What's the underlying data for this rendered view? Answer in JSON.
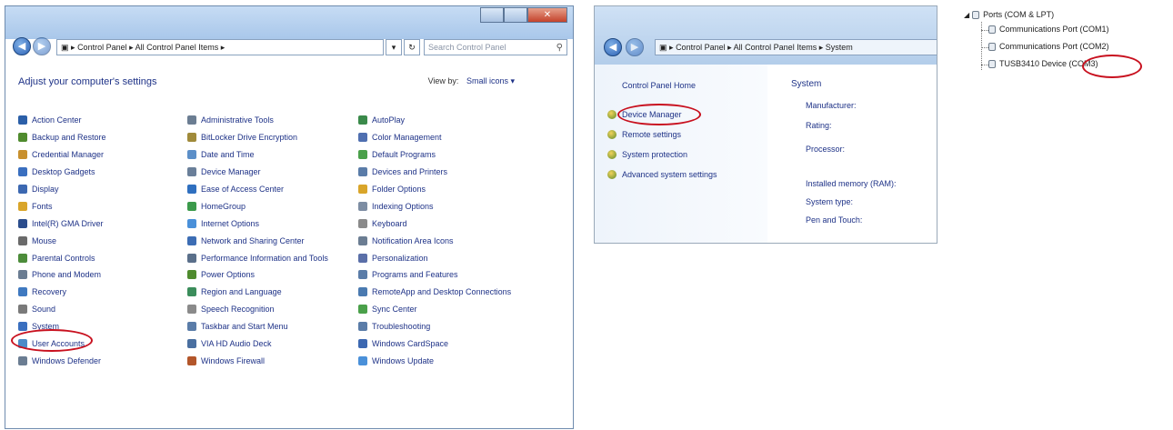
{
  "control_panel": {
    "breadcrumb": [
      "Control Panel",
      "All Control Panel Items"
    ],
    "search_placeholder": "Search Control Panel",
    "heading": "Adjust your computer's settings",
    "view_by_label": "View by:",
    "view_by_value": "Small icons",
    "columns": [
      [
        {
          "label": "Action Center",
          "color": "#2b5fa8"
        },
        {
          "label": "Backup and Restore",
          "color": "#4f8b2e"
        },
        {
          "label": "Credential Manager",
          "color": "#c8902e"
        },
        {
          "label": "Desktop Gadgets",
          "color": "#3a6fbf"
        },
        {
          "label": "Display",
          "color": "#3c68b1"
        },
        {
          "label": "Fonts",
          "color": "#d9a52a"
        },
        {
          "label": "Intel(R) GMA Driver",
          "color": "#2b4d8c"
        },
        {
          "label": "Mouse",
          "color": "#6a6a6a"
        },
        {
          "label": "Parental Controls",
          "color": "#4c8c3a"
        },
        {
          "label": "Phone and Modem",
          "color": "#6b7d92"
        },
        {
          "label": "Recovery",
          "color": "#3f79c0"
        },
        {
          "label": "Sound",
          "color": "#7a7a7a"
        },
        {
          "label": "System",
          "color": "#3a6fbf"
        },
        {
          "label": "User Accounts",
          "color": "#4b8bc8"
        },
        {
          "label": "Windows Defender",
          "color": "#6b7d92"
        }
      ],
      [
        {
          "label": "Administrative Tools",
          "color": "#6b7d92"
        },
        {
          "label": "BitLocker Drive Encryption",
          "color": "#a08a3a"
        },
        {
          "label": "Date and Time",
          "color": "#5c8fc8"
        },
        {
          "label": "Device Manager",
          "color": "#6a7f99"
        },
        {
          "label": "Ease of Access Center",
          "color": "#2f6fbf"
        },
        {
          "label": "HomeGroup",
          "color": "#3b9a4b"
        },
        {
          "label": "Internet Options",
          "color": "#4a90d9"
        },
        {
          "label": "Network and Sharing Center",
          "color": "#3c6db4"
        },
        {
          "label": "Performance Information and Tools",
          "color": "#5a6f8a"
        },
        {
          "label": "Power Options",
          "color": "#4f8b2e"
        },
        {
          "label": "Region and Language",
          "color": "#3b8d5b"
        },
        {
          "label": "Speech Recognition",
          "color": "#8a8a8a"
        },
        {
          "label": "Taskbar and Start Menu",
          "color": "#5a7ca8"
        },
        {
          "label": "VIA HD Audio Deck",
          "color": "#4a6fa0"
        },
        {
          "label": "Windows Firewall",
          "color": "#b3562a"
        }
      ],
      [
        {
          "label": "AutoPlay",
          "color": "#3a8a4a"
        },
        {
          "label": "Color Management",
          "color": "#4f6fb0"
        },
        {
          "label": "Default Programs",
          "color": "#4aa04a"
        },
        {
          "label": "Devices and Printers",
          "color": "#5a7ca8"
        },
        {
          "label": "Folder Options",
          "color": "#d9a52a"
        },
        {
          "label": "Indexing Options",
          "color": "#7d8da3"
        },
        {
          "label": "Keyboard",
          "color": "#8a8a8a"
        },
        {
          "label": "Notification Area Icons",
          "color": "#6b7d92"
        },
        {
          "label": "Personalization",
          "color": "#5a6fa8"
        },
        {
          "label": "Programs and Features",
          "color": "#5a7ca8"
        },
        {
          "label": "RemoteApp and Desktop Connections",
          "color": "#4a7ab0"
        },
        {
          "label": "Sync Center",
          "color": "#4aa04a"
        },
        {
          "label": "Troubleshooting",
          "color": "#5a7ca8"
        },
        {
          "label": "Windows CardSpace",
          "color": "#3c68b1"
        },
        {
          "label": "Windows Update",
          "color": "#4a90d9"
        }
      ]
    ]
  },
  "system_window": {
    "breadcrumb": [
      "Control Panel",
      "All Control Panel Items",
      "System"
    ],
    "home_link": "Control Panel Home",
    "links": [
      "Device Manager",
      "Remote settings",
      "System protection",
      "Advanced system settings"
    ],
    "section_title": "System",
    "properties": [
      "Manufacturer:",
      "Rating:",
      "Processor:",
      "Installed memory (RAM):",
      "System type:",
      "Pen and Touch:"
    ]
  },
  "device_manager": {
    "category": "Ports (COM & LPT)",
    "devices": [
      "Communications Port (COM1)",
      "Communications Port (COM2)",
      "TUSB3410 Device (COM3)"
    ]
  },
  "highlight_color": "#c8101e"
}
